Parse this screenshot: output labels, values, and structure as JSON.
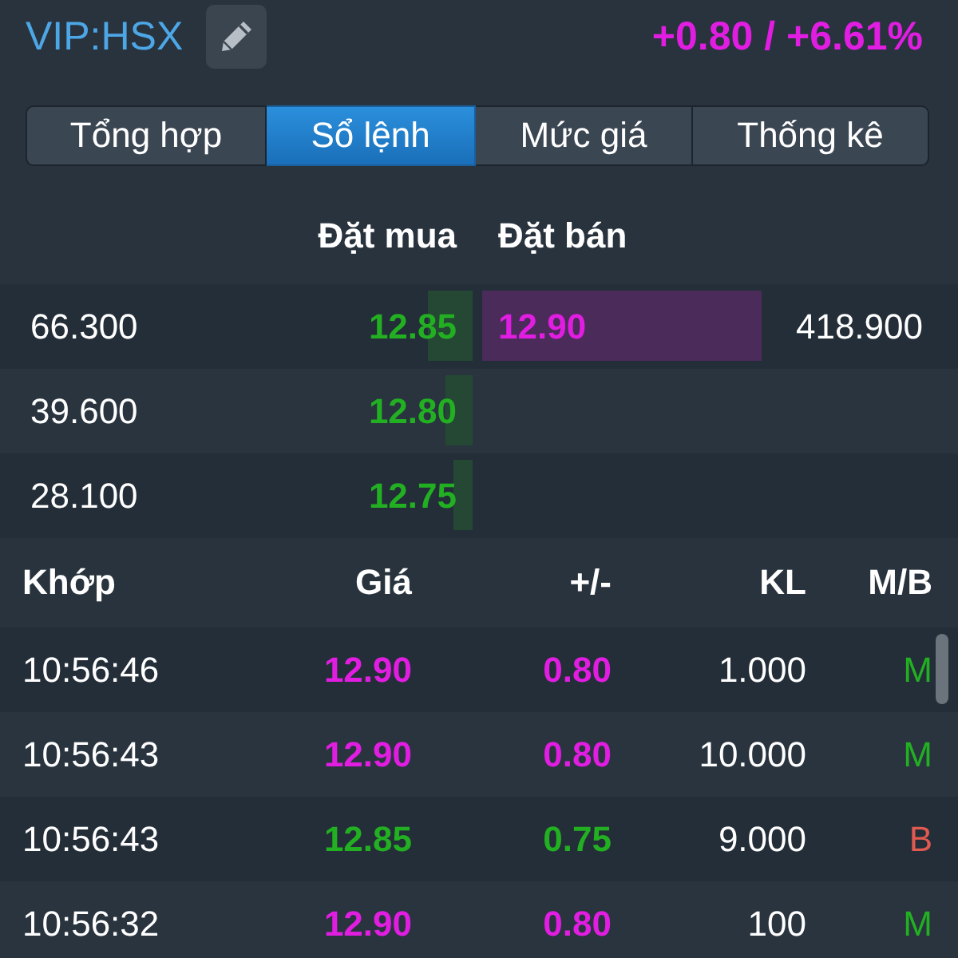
{
  "header": {
    "symbol": "VIP:HSX",
    "change": "+0.80 / +6.61%"
  },
  "tabs": [
    {
      "label": "Tổng hợp",
      "selected": false
    },
    {
      "label": "Sổ lệnh",
      "selected": true
    },
    {
      "label": "Mức giá",
      "selected": false
    },
    {
      "label": "Thống kê",
      "selected": false
    }
  ],
  "order_book": {
    "columns": [
      "Đặt mua",
      "Đặt bán"
    ],
    "rows": [
      {
        "bid": {
          "volume": "66.300",
          "price": "12.85",
          "color": "#22b022"
        },
        "ask": {
          "price": "12.90",
          "volume": "418.900",
          "color": "#e21de2"
        }
      },
      {
        "bid": {
          "volume": "39.600",
          "price": "12.80",
          "color": "#22b022"
        }
      },
      {
        "bid": {
          "volume": "28.100",
          "price": "12.75",
          "color": "#22b022"
        }
      }
    ]
  },
  "trades": {
    "columns": [
      "Khớp",
      "Giá",
      "+/-",
      "KL",
      "M/B"
    ],
    "rows": [
      {
        "time": "10:56:46",
        "price": "12.90",
        "change": "0.80",
        "color": "#e21de2",
        "volume": "1.000",
        "side": {
          "text": "M",
          "color": "#22b022"
        }
      },
      {
        "time": "10:56:43",
        "price": "12.90",
        "change": "0.80",
        "color": "#e21de2",
        "volume": "10.000",
        "side": {
          "text": "M",
          "color": "#22b022"
        }
      },
      {
        "time": "10:56:43",
        "price": "12.85",
        "change": "0.75",
        "color": "#22b022",
        "volume": "9.000",
        "side": {
          "text": "B",
          "color": "#e05a50"
        }
      },
      {
        "time": "10:56:32",
        "price": "12.90",
        "change": "0.80",
        "color": "#e21de2",
        "volume": "100",
        "side": {
          "text": "M",
          "color": "#22b022"
        }
      }
    ]
  }
}
